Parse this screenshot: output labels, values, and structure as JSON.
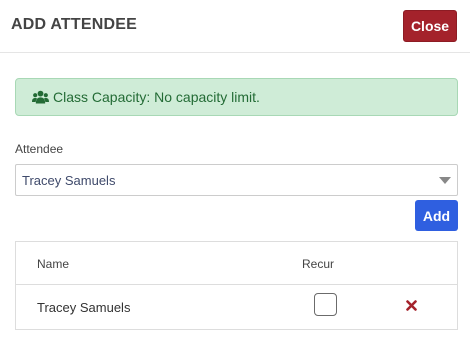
{
  "header": {
    "title": "ADD ATTENDEE",
    "close_label": "Close"
  },
  "alert": {
    "icon": "users-icon",
    "text": "Class Capacity: No capacity limit."
  },
  "attendee_field": {
    "label": "Attendee",
    "selected_value": "Tracey Samuels"
  },
  "add_label": "Add",
  "table": {
    "columns": [
      "Name",
      "Recur"
    ],
    "rows": [
      {
        "name": "Tracey Samuels",
        "recur": false
      }
    ]
  },
  "colors": {
    "close_button": "#a4222b",
    "add_button": "#2f5fe0",
    "alert_bg": "#cfecd7",
    "alert_text": "#236b35",
    "remove_icon": "#a4222b"
  }
}
